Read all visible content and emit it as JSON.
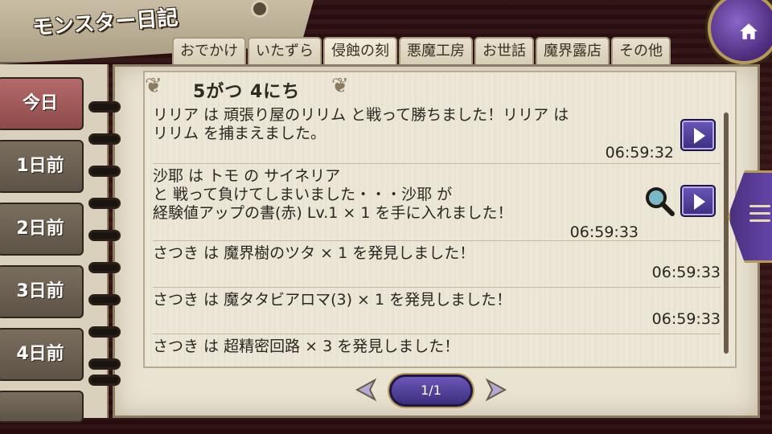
{
  "header": {
    "title": "モンスター日記"
  },
  "tabs": [
    {
      "label": "おでかけ"
    },
    {
      "label": "いたずら"
    },
    {
      "label": "侵蝕の刻"
    },
    {
      "label": "悪魔工房"
    },
    {
      "label": "お世話"
    },
    {
      "label": "魔界露店"
    },
    {
      "label": "その他"
    }
  ],
  "days": [
    {
      "label": "今日"
    },
    {
      "label": "1日前"
    },
    {
      "label": "2日前"
    },
    {
      "label": "3日前"
    },
    {
      "label": "4日前"
    }
  ],
  "diary": {
    "date": "5がつ 4にち",
    "entries": [
      {
        "text": "リリア は 頑張り屋のリリム と戦って勝ちました！リリア は\nリリム を捕まえました。",
        "time": "06:59:32"
      },
      {
        "text": "沙耶 は トモ の サイネリア\nと 戦って負けてしまいました・・・沙耶 が\n経験値アップの書(赤) Lv.1 × 1 を手に入れました！",
        "time": "06:59:33"
      },
      {
        "text": "さつき は 魔界樹のツタ × 1 を発見しました！",
        "time": "06:59:33"
      },
      {
        "text": "さつき は 魔タタビアロマ(3) × 1 を発見しました！",
        "time": "06:59:33"
      },
      {
        "text": "さつき は 超精密回路 × 3 を発見しました！",
        "time": ""
      }
    ]
  },
  "pager": {
    "label": "1/1"
  },
  "colors": {
    "accent": "#4a3080",
    "active_day": "#b46a6a"
  }
}
